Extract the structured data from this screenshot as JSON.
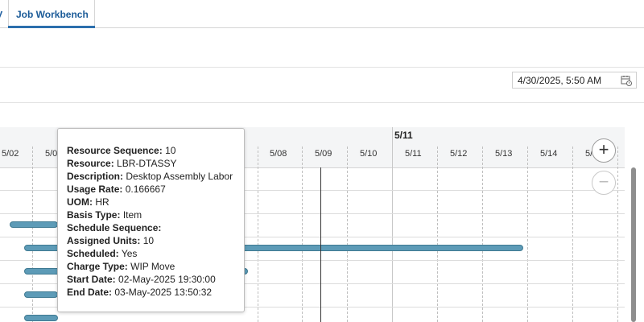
{
  "tabs": {
    "previous_partial": "y",
    "active": "Job Workbench"
  },
  "date_field": {
    "value": "4/30/2025, 5:50 AM",
    "icon": "calendar-clock-icon"
  },
  "gantt": {
    "week_label": "5/11",
    "days": [
      "5/02",
      "5/0",
      "5/08",
      "5/09",
      "5/10",
      "5/11",
      "5/12",
      "5/13",
      "5/14",
      "5/"
    ],
    "zoom_in_label": "+",
    "zoom_out_label": "−",
    "bar_color": "#5d9bb7"
  },
  "tooltip": {
    "rows": [
      {
        "label": "Resource Sequence:",
        "value": "10"
      },
      {
        "label": "Resource:",
        "value": "LBR-DTASSY"
      },
      {
        "label": "Description:",
        "value": "Desktop Assembly Labor"
      },
      {
        "label": "Usage Rate:",
        "value": "0.166667"
      },
      {
        "label": "UOM:",
        "value": "HR"
      },
      {
        "label": "Basis Type:",
        "value": "Item"
      },
      {
        "label": "Schedule Sequence:",
        "value": ""
      },
      {
        "label": "Assigned Units:",
        "value": "10"
      },
      {
        "label": "Scheduled:",
        "value": "Yes"
      },
      {
        "label": "Charge Type:",
        "value": "WIP Move"
      },
      {
        "label": "Start Date:",
        "value": "02-May-2025 19:30:00"
      },
      {
        "label": "End Date:",
        "value": "03-May-2025 13:50:32"
      }
    ]
  }
}
